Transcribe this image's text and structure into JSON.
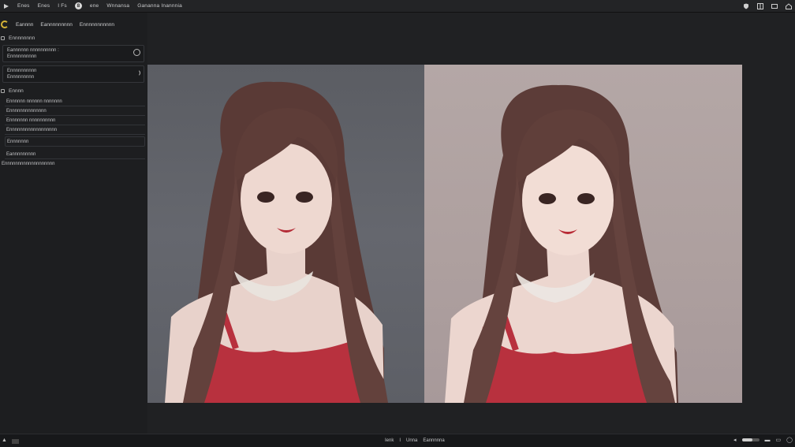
{
  "menubar": {
    "items": [
      "Enes",
      "Enes",
      "I Fs",
      "ene",
      "Wnnansa",
      "Gananna Inannnia"
    ],
    "badge": "8",
    "right_icons": [
      "shield-icon",
      "window-icon",
      "restore-icon",
      "home-icon"
    ]
  },
  "toolbar": {
    "tabs": [
      "Eannnn",
      "Eannnnnnnnn",
      "Ennnnnnnnnnn"
    ]
  },
  "sidebar": {
    "section1": {
      "label": "Ennnnnnnn"
    },
    "field1": {
      "line1": "Eannnnnn nnnnnnnnnn :",
      "line2": "Ennnnnnnnnn"
    },
    "field2": {
      "line1": "Ennnnnnnnnn",
      "line2": "Ennnnnnnnn"
    },
    "section2": {
      "label": "Ennnn"
    },
    "rows": [
      "Ennnnnn  nnnnnn  nnnnnnn",
      "Ennnnnnnnnnnnnn",
      "Ennnnnnn  nnnnnnnnnn",
      "Ennnnnnnnnnnnnnnnnn"
    ],
    "boxed_row": "Ennnnnnn",
    "row_last": "Eannnnnnnnn",
    "footer": "Ennnnnnnnnnnnnnnnnnn"
  },
  "statusbar": {
    "center": [
      "Ienk",
      "I",
      "Unna",
      "Eannnnna"
    ],
    "zoom_fraction": 0.6
  },
  "colors": {
    "accent": "#d6b437",
    "left_background": "#5f6168",
    "right_background": "#b0a2a1",
    "dress": "#b8313e"
  }
}
